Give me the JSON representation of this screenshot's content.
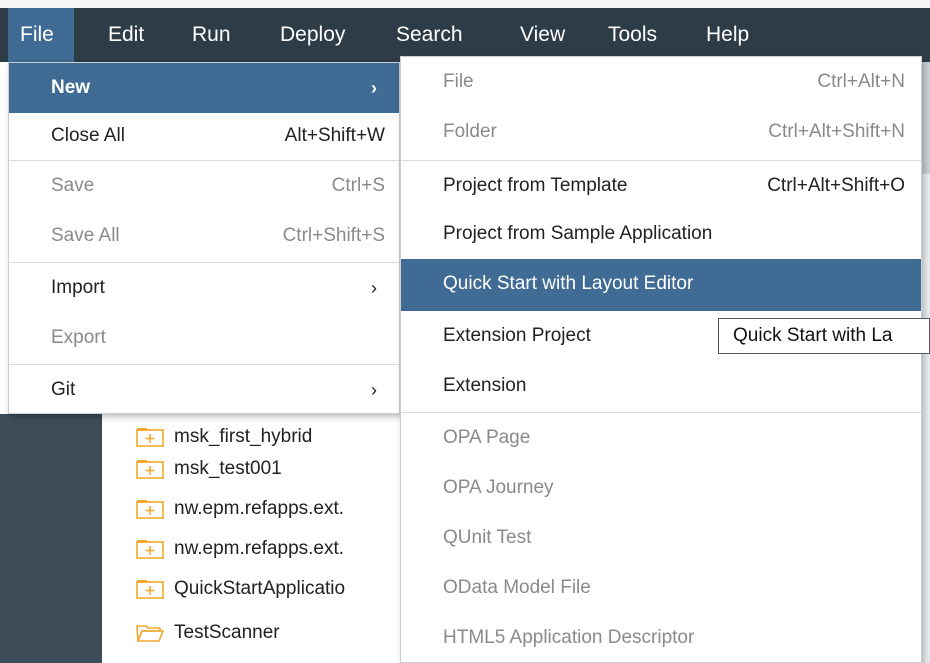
{
  "menubar": {
    "items": [
      {
        "label": "File"
      },
      {
        "label": "Edit"
      },
      {
        "label": "Run"
      },
      {
        "label": "Deploy"
      },
      {
        "label": "Search"
      },
      {
        "label": "View"
      },
      {
        "label": "Tools"
      },
      {
        "label": "Help"
      }
    ]
  },
  "file_menu": {
    "new": {
      "label": "New",
      "arrow": "›"
    },
    "close_all": {
      "label": "Close All",
      "shortcut": "Alt+Shift+W"
    },
    "save": {
      "label": "Save",
      "shortcut": "Ctrl+S"
    },
    "save_all": {
      "label": "Save All",
      "shortcut": "Ctrl+Shift+S"
    },
    "import": {
      "label": "Import",
      "arrow": "›"
    },
    "export": {
      "label": "Export"
    },
    "git": {
      "label": "Git",
      "arrow": "›"
    }
  },
  "new_submenu": {
    "file": {
      "label": "File",
      "shortcut": "Ctrl+Alt+N"
    },
    "folder": {
      "label": "Folder",
      "shortcut": "Ctrl+Alt+Shift+N"
    },
    "project_from_template": {
      "label": "Project from Template",
      "shortcut": "Ctrl+Alt+Shift+O"
    },
    "project_from_sample": {
      "label": "Project from Sample Application"
    },
    "quick_start": {
      "label": "Quick Start with Layout Editor"
    },
    "extension_project": {
      "label": "Extension Project"
    },
    "extension": {
      "label": "Extension"
    },
    "opa_page": {
      "label": "OPA Page"
    },
    "opa_journey": {
      "label": "OPA Journey"
    },
    "qunit_test": {
      "label": "QUnit Test"
    },
    "odata_model": {
      "label": "OData Model File"
    },
    "html5_descriptor": {
      "label": "HTML5 Application Descriptor"
    }
  },
  "tooltip": {
    "text": "Quick Start with La"
  },
  "workspace_tree": {
    "items": [
      {
        "label": "msk_first_hybrid",
        "icon": "folder-plus-icon"
      },
      {
        "label": "msk_test001",
        "icon": "folder-plus-icon"
      },
      {
        "label": "nw.epm.refapps.ext.",
        "icon": "folder-plus-icon"
      },
      {
        "label": "nw.epm.refapps.ext.",
        "icon": "folder-plus-icon"
      },
      {
        "label": "QuickStartApplicatio",
        "icon": "folder-plus-icon"
      },
      {
        "label": "TestScanner",
        "icon": "folder-open-icon"
      }
    ]
  },
  "colors": {
    "menubar": "#2e3c48",
    "highlight": "#3f6b94",
    "folder": "#f0a830"
  }
}
